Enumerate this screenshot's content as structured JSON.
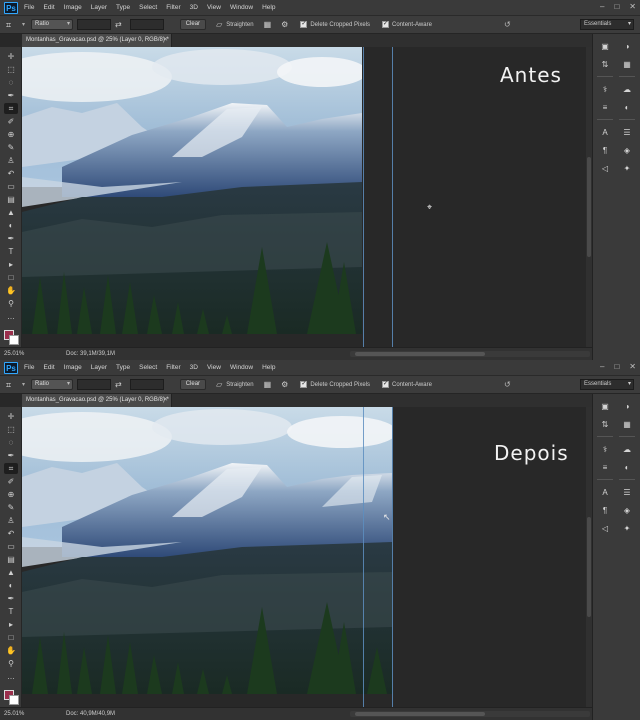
{
  "menubar": {
    "logo": "Ps",
    "items": [
      "File",
      "Edit",
      "Image",
      "Layer",
      "Type",
      "Select",
      "Filter",
      "3D",
      "View",
      "Window",
      "Help"
    ],
    "window_controls": [
      "–",
      "□",
      "✕"
    ]
  },
  "options": {
    "crop_icon": "crop-icon",
    "ratio_label": "Ratio",
    "clear_label": "Clear",
    "straighten_label": "Straighten",
    "delete_cropped_label": "Delete Cropped Pixels",
    "content_aware_label": "Content-Aware",
    "workspace_label": "Essentials"
  },
  "document": {
    "tab_title": "Montanhas_Gravacao.psd @ 25% (Layer 0, RGB/8) *",
    "zoom": "25.01%"
  },
  "panels": [
    {
      "id": "before",
      "overlay_label": "Antes",
      "doc_size": "Doc: 39,1M/39,1M"
    },
    {
      "id": "after",
      "overlay_label": "Depois",
      "doc_size": "Doc: 40,9M/40,9M"
    }
  ],
  "tools": [
    "move-tool",
    "marquee-tool",
    "lasso-tool",
    "quick-select-tool",
    "crop-tool",
    "eyedropper-tool",
    "healing-tool",
    "brush-tool",
    "clone-stamp-tool",
    "history-brush-tool",
    "eraser-tool",
    "gradient-tool",
    "blur-tool",
    "dodge-tool",
    "pen-tool",
    "type-tool",
    "path-select-tool",
    "rectangle-tool",
    "hand-tool",
    "zoom-tool",
    "more-tools"
  ],
  "colors": {
    "foreground": "#9b2f4c",
    "background": "#ffffff",
    "guide": "#5d8ec0"
  }
}
